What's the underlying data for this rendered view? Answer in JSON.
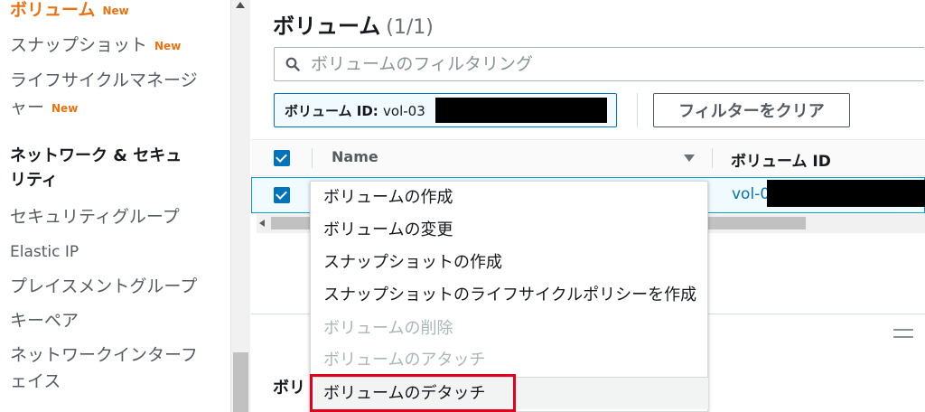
{
  "sidebar": {
    "items": [
      {
        "label": "ボリューム",
        "badge": "New"
      },
      {
        "label": "スナップショット",
        "badge": "New"
      },
      {
        "label": "ライフサイクルマネージ",
        "badge": ""
      },
      {
        "label": "ャー",
        "badge": "New"
      }
    ],
    "section_heading_line1": "ネットワーク & セキュ",
    "section_heading_line2": "リティ",
    "network_items": [
      "セキュリティグループ",
      "Elastic IP",
      "プレイスメントグループ",
      "キーペア",
      "ネットワークインターフ",
      "ェイス"
    ]
  },
  "main": {
    "title": "ボリューム",
    "count": "(1/1)",
    "filter_placeholder": "ボリュームのフィルタリング",
    "token_key": "ボリューム ID:",
    "token_value": "vol-03",
    "clear_filter_label": "フィルターをクリア",
    "table": {
      "columns": [
        "Name",
        "ボリューム ID"
      ],
      "row": {
        "volume_id_prefix": "vol-0"
      }
    },
    "bottom_panel_title": "ボリ"
  },
  "context_menu": {
    "items": [
      {
        "label": "ボリュームの作成",
        "enabled": true
      },
      {
        "label": "ボリュームの変更",
        "enabled": true
      },
      {
        "label": "スナップショットの作成",
        "enabled": true
      },
      {
        "label": "スナップショットのライフサイクルポリシーを作成",
        "enabled": true
      },
      {
        "label": "ボリュームの削除",
        "enabled": false
      },
      {
        "label": "ボリュームのアタッチ",
        "enabled": false
      },
      {
        "label": "ボリュームのデタッチ",
        "enabled": true
      }
    ]
  },
  "colors": {
    "accent_orange": "#ec7211",
    "link_blue": "#0073bb",
    "highlight_red": "#e3001b"
  },
  "icons": [
    "search-icon",
    "sort-descending-icon",
    "checkbox-checked-icon",
    "resize-handle-icon",
    "scroll-up-arrow-icon",
    "scroll-left-arrow-icon"
  ]
}
